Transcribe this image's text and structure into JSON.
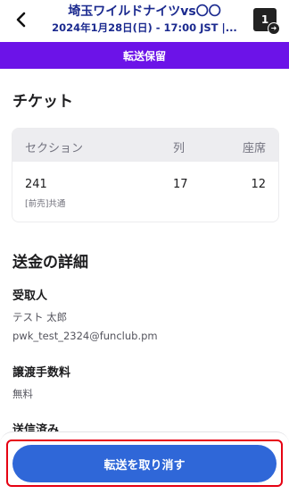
{
  "header": {
    "title": "埼玉ワイルドナイツvs〇〇",
    "subtitle": "2024年1月28日(日) - 17:00 JST  |...",
    "ticket_count": "1",
    "icons": {
      "back": "chevron-left-icon",
      "ticket": "ticket-transfer-icon"
    }
  },
  "status_banner": {
    "text": "転送保留",
    "color": "#6c13e8"
  },
  "ticket_section": {
    "title": "チケット",
    "columns": [
      "セクション",
      "列",
      "座席"
    ],
    "rows": [
      {
        "section": "241",
        "row": "17",
        "seat": "12",
        "note": "[前売]共通"
      }
    ]
  },
  "details": {
    "title": "送金の詳細",
    "recipient_label": "受取人",
    "recipient_name": "テスト 太郎",
    "recipient_email": "pwk_test_2324@funclub.pm",
    "fee_label": "譲渡手数料",
    "fee_value": "無料",
    "sent_label": "送信済み"
  },
  "footer": {
    "cancel_label": "転送を取り消す",
    "accent": "#2f67d8",
    "highlight": "#e60012"
  }
}
